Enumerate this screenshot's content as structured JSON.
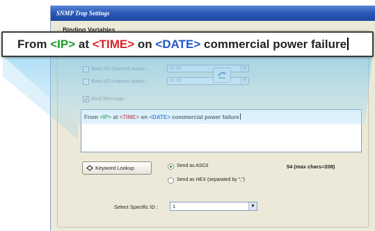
{
  "window": {
    "title": "SNMP Trap Settings"
  },
  "group": {
    "label": "Binding Variables"
  },
  "bindings": [
    {
      "label": "Bind I/O channel status :",
      "value": "DI 00"
    },
    {
      "label": "Bind I/O channel status :",
      "value": "DI 00"
    }
  ],
  "bind_message": {
    "label": "Bind Message",
    "checked": true
  },
  "message": {
    "parts": [
      {
        "text": "From ",
        "type": "plain"
      },
      {
        "text": "<IP>",
        "type": "ip"
      },
      {
        "text": " at ",
        "type": "plain"
      },
      {
        "text": "<TIME>",
        "type": "time"
      },
      {
        "text": " on ",
        "type": "plain"
      },
      {
        "text": "<DATE>",
        "type": "date"
      },
      {
        "text": " commercial power failure",
        "type": "plain"
      }
    ]
  },
  "keyword_lookup_label": "Keyword Lookup",
  "send_options": [
    {
      "label": "Send as ASCII",
      "selected": true
    },
    {
      "label": "Send as HEX (separated by \",\")",
      "selected": false
    }
  ],
  "char_count": "54 (max chars=208)",
  "select_id": {
    "label": "Select Specific ID :",
    "value": "1"
  },
  "colors": {
    "ip": "#1c9a2c",
    "time": "#d8232a",
    "date": "#2155c8",
    "title_bar": "#2d5bb8"
  },
  "icons": [
    "refresh-icon",
    "keyword-lookup-icon",
    "dropdown-arrow-icon"
  ]
}
